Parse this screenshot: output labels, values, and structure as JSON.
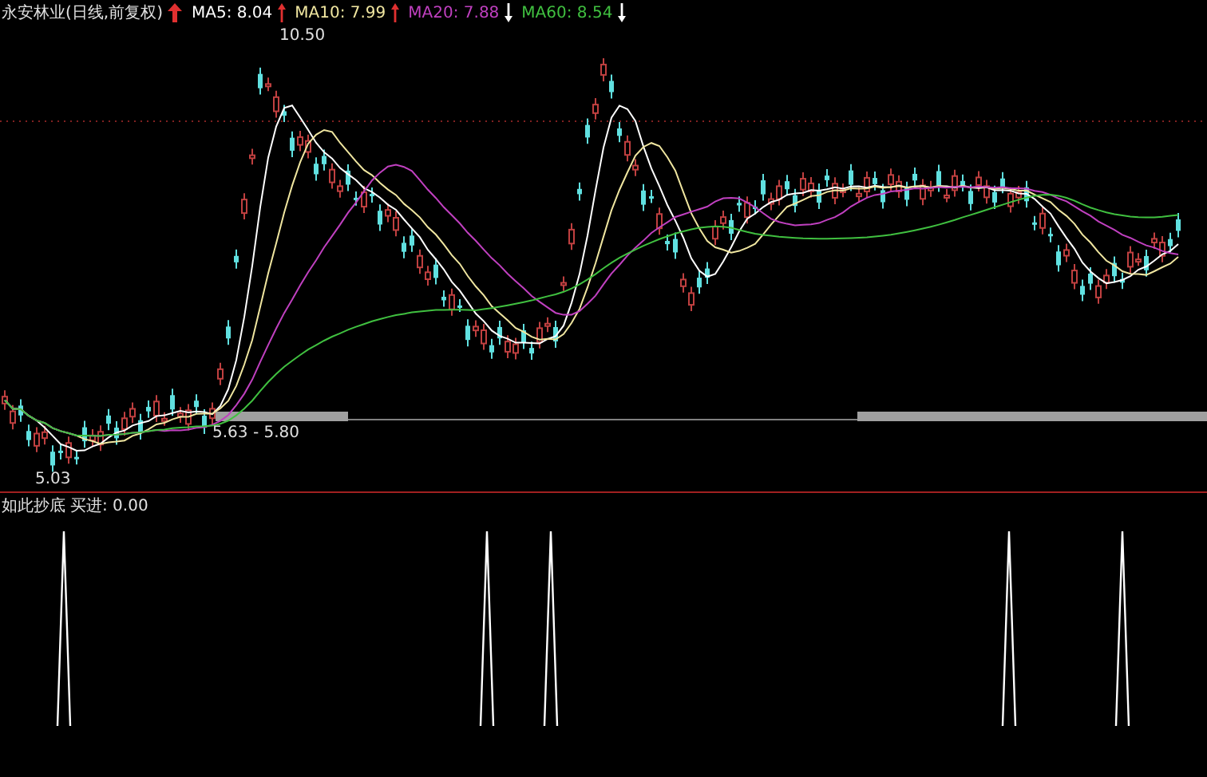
{
  "price_panel": {
    "title": "永安林业(日线,前复权)",
    "indicators": [
      {
        "label": "MA5: 8.04",
        "color": "#ffffff",
        "rising": true
      },
      {
        "label": "MA10: 7.99",
        "color": "#f0e6a0",
        "rising": true
      },
      {
        "label": "MA20: 7.88",
        "color": "#c040c0",
        "rising": false
      },
      {
        "label": "MA60: 8.54",
        "color": "#40c040",
        "rising": false
      }
    ],
    "annotations": [
      {
        "kind": "high",
        "text": "10.50"
      },
      {
        "kind": "low",
        "text": "5.03"
      },
      {
        "kind": "range",
        "text": "5.63 - 5.80"
      }
    ]
  },
  "signal_panel": {
    "label": "如此抄底",
    "reading": "买进: 0.00"
  }
}
